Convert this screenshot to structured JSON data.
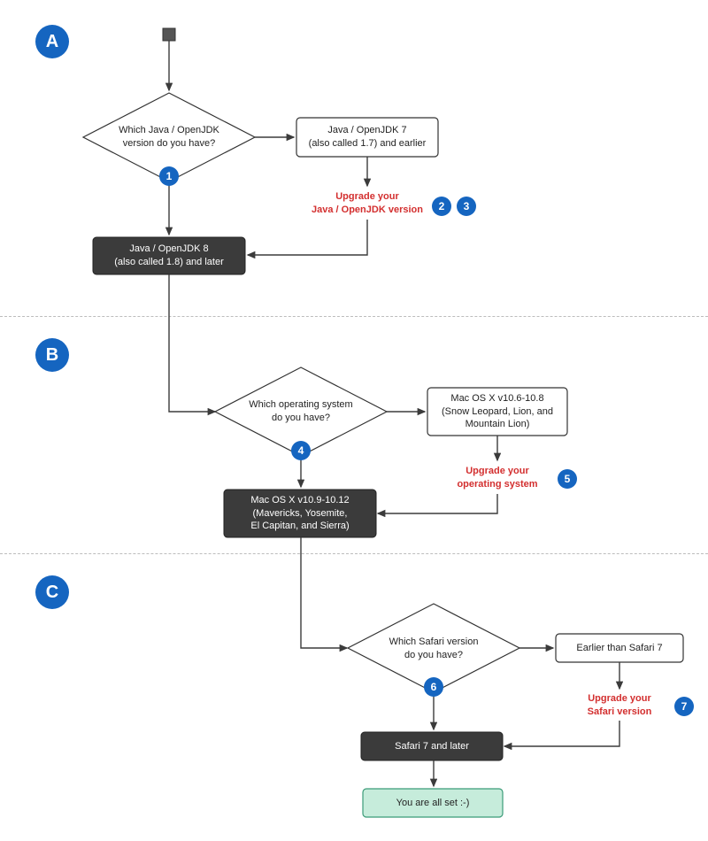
{
  "sections": {
    "a": "A",
    "b": "B",
    "c": "C"
  },
  "badges": {
    "b1": "1",
    "b2": "2",
    "b3": "3",
    "b4": "4",
    "b5": "5",
    "b6": "6",
    "b7": "7"
  },
  "chart_data": {
    "type": "flowchart",
    "sections": [
      {
        "letter": "A",
        "start": true,
        "decision": "Which Java / OpenJDK version do you have?",
        "decision_badge": 1,
        "right_branch": {
          "box": "Java / OpenJDK 7 (also called 1.7) and earlier",
          "action": "Upgrade your Java / OpenJDK version",
          "action_badges": [
            2,
            3
          ]
        },
        "down_result": "Java / OpenJDK 8 (also called 1.8)  and later"
      },
      {
        "letter": "B",
        "decision": "Which operating system do you have?",
        "decision_badge": 4,
        "right_branch": {
          "box": "Mac OS X v10.6-10.8 (Snow Leopard, Lion, and Mountain Lion)",
          "action": "Upgrade your operating system",
          "action_badges": [
            5
          ]
        },
        "down_result": "Mac OS X v10.9-10.12 (Mavericks, Yosemite, El Capitan, and Sierra)"
      },
      {
        "letter": "C",
        "decision": "Which Safari version do you have?",
        "decision_badge": 6,
        "right_branch": {
          "box": "Earlier than Safari 7",
          "action": "Upgrade your Safari version",
          "action_badges": [
            7
          ]
        },
        "down_result": "Safari 7 and later",
        "terminal": "You are all set :-)"
      }
    ]
  },
  "labels": {
    "dec_a_l1": "Which Java / OpenJDK",
    "dec_a_l2": "version do you have?",
    "box_a_l1": "Java / OpenJDK 7",
    "box_a_l2": "(also called 1.7) and earlier",
    "red_a_l1": "Upgrade your",
    "red_a_l2": "Java / OpenJDK version",
    "dark_a_l1": "Java / OpenJDK 8",
    "dark_a_l2": "(also called 1.8)  and later",
    "dec_b_l1": "Which operating system",
    "dec_b_l2": "do you have?",
    "box_b_l1": "Mac OS X v10.6-10.8",
    "box_b_l2": "(Snow Leopard, Lion, and",
    "box_b_l3": "Mountain Lion)",
    "red_b_l1": "Upgrade your",
    "red_b_l2": "operating system",
    "dark_b_l1": "Mac OS X v10.9-10.12",
    "dark_b_l2": "(Mavericks, Yosemite,",
    "dark_b_l3": "El Capitan, and Sierra)",
    "dec_c_l1": "Which Safari version",
    "dec_c_l2": "do you have?",
    "box_c_l1": "Earlier than Safari 7",
    "red_c_l1": "Upgrade your",
    "red_c_l2": "Safari version",
    "dark_c_l1": "Safari 7 and later",
    "done_l1": "You are all set :-)"
  }
}
